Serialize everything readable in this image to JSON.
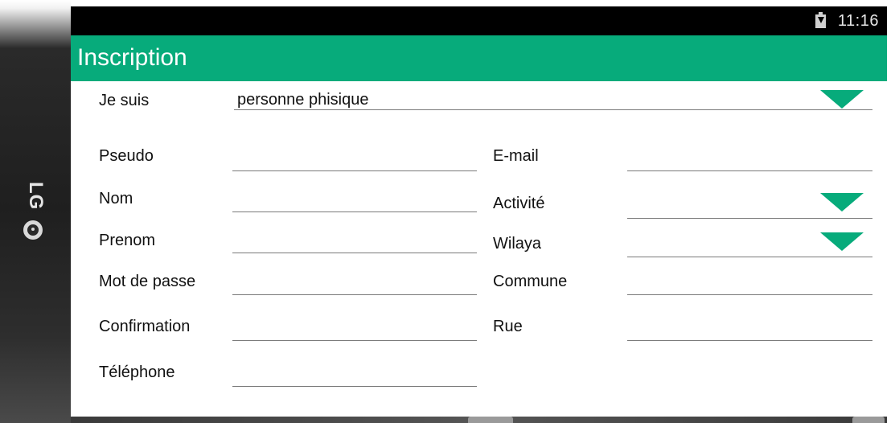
{
  "device": {
    "brand": "LG"
  },
  "status_bar": {
    "time": "11:16",
    "icon": "battery-charging-icon"
  },
  "action_bar": {
    "title": "Inscription",
    "color": "#07ab7b"
  },
  "form": {
    "je_suis": {
      "label": "Je suis",
      "value": "personne phisique",
      "icon": "dropdown-arrow-icon"
    },
    "left_fields": [
      {
        "label": "Pseudo",
        "value": ""
      },
      {
        "label": "Nom",
        "value": ""
      },
      {
        "label": "Prenom",
        "value": ""
      },
      {
        "label": "Mot de passe",
        "value": ""
      },
      {
        "label": "Confirmation",
        "value": ""
      },
      {
        "label": "Téléphone",
        "value": ""
      }
    ],
    "right_fields": [
      {
        "label": "E-mail",
        "value": "",
        "type": "text"
      },
      {
        "label": "Activité",
        "value": "",
        "type": "dropdown"
      },
      {
        "label": "Wilaya",
        "value": "",
        "type": "dropdown"
      },
      {
        "label": "Commune",
        "value": "",
        "type": "text"
      },
      {
        "label": "Rue",
        "value": "",
        "type": "text"
      }
    ]
  }
}
